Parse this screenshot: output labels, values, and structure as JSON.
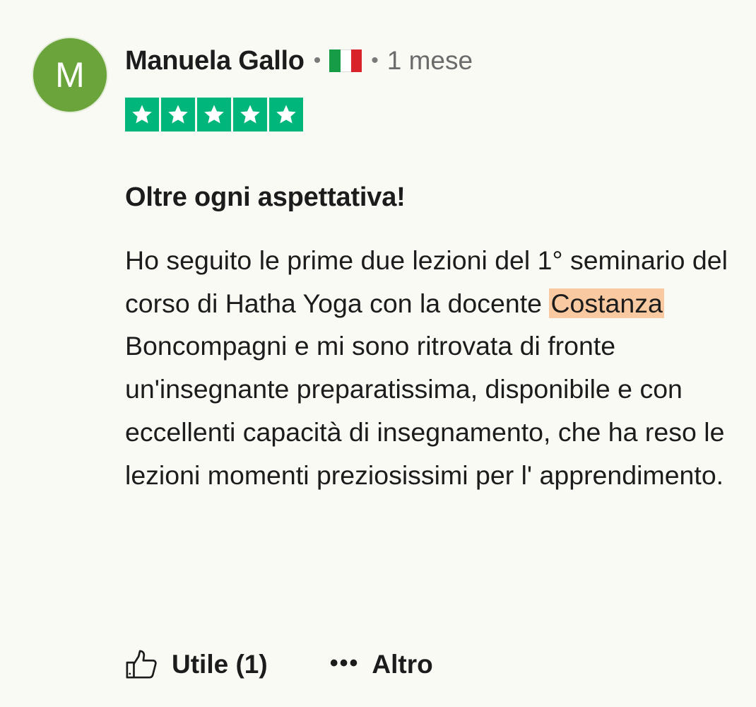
{
  "review": {
    "avatar_initial": "M",
    "avatar_color": "#6aa43a",
    "author": "Manuela Gallo",
    "separator": "•",
    "country_flag": "italy-flag-icon",
    "time_ago": "1 mese",
    "rating": 5,
    "rating_max": 5,
    "star_color": "#00b67a",
    "title": "Oltre ogni aspettativa!",
    "body_before": "Ho seguito le prime due lezioni del 1° seminario del corso di Hatha Yoga con la docente ",
    "body_highlight": "Costanza",
    "body_after": " Boncompagni e mi sono ritrovata di fronte un'insegnante preparatissima, disponibile e con eccellenti capacità di insegnamento, che ha reso le lezioni momenti preziosissimi per l' apprendimento.",
    "highlight_color": "#f9c9a1"
  },
  "actions": {
    "useful_icon": "thumbs-up-icon",
    "useful_label": "Utile (1)",
    "more_icon": "more-dots-icon",
    "more_dots": "•••",
    "more_label": "Altro"
  }
}
